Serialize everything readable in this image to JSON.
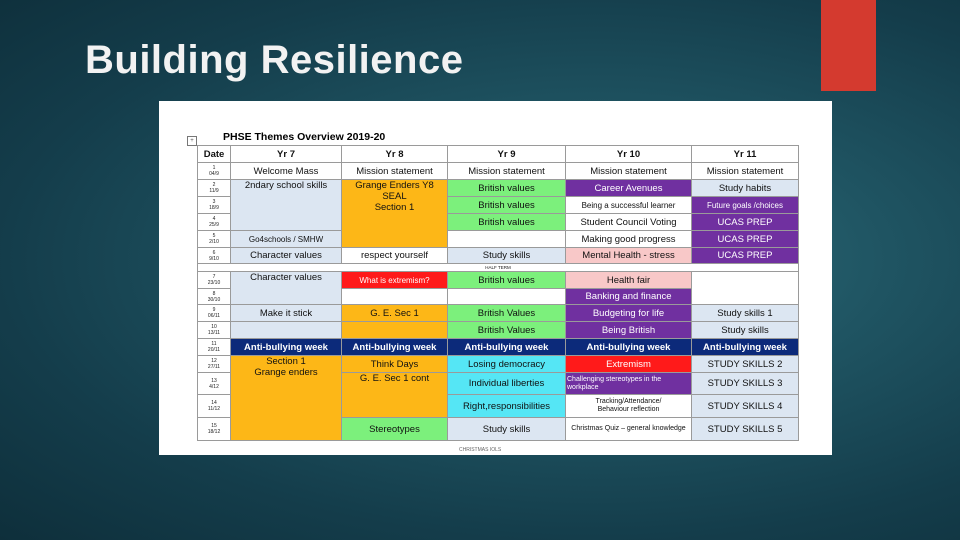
{
  "slide": {
    "title": "Building Resilience"
  },
  "doc": {
    "title": "PHSE Themes Overview 2019-20",
    "marker": "+",
    "half_term": "HALF TERM",
    "christmas": "CHRISTMAS  IOLS",
    "headers": [
      "Date",
      "Yr 7",
      "Yr 8",
      "Yr 9",
      "Yr 10",
      "Yr 11"
    ],
    "dates": [
      "1\n04/9",
      "2\n11/9",
      "3\n18/9",
      "4\n25/9",
      "5\n2/10",
      "6\n9/10",
      "7\n23/10",
      "8\n30/10",
      "9\n06/11",
      "10\n13/11",
      "11\n20/11",
      "12\n27/11",
      "13\n4/12",
      "14\n11/12",
      "15\n18/12"
    ],
    "cells": {
      "r1": [
        "Welcome Mass",
        "Mission statement",
        "Mission statement",
        "Mission statement",
        "Mission statement"
      ],
      "r2": [
        "2ndary school skills",
        "Grange Enders Y8\nSEAL\nSection 1",
        "British values",
        "Career Avenues",
        "Study habits"
      ],
      "r3": [
        "British values",
        "Being a successful learner",
        "Future goals /choices"
      ],
      "r4": [
        "British values",
        "Student Council Voting",
        "UCAS PREP"
      ],
      "r5": [
        "Go4schools / SMHW",
        "Making good progress",
        "UCAS PREP"
      ],
      "r6": [
        "Character values",
        "respect yourself",
        "Study skills",
        "Mental Health - stress",
        "UCAS PREP"
      ],
      "r7": [
        "Character values",
        "What is extremism?",
        "British values",
        "Health fair"
      ],
      "r8": [
        "Banking and finance"
      ],
      "r9": [
        "Make it stick",
        "G. E. Sec 1",
        "British Values",
        "Budgeting for life",
        "Study skills  1"
      ],
      "r10": [
        "British Values",
        "Being British",
        "Study skills"
      ],
      "r11": [
        "Anti-bullying week",
        "Anti-bullying week",
        "Anti-bullying week",
        "Anti-bullying week",
        "Anti-bullying week"
      ],
      "r12": [
        "Section 1\nGrange enders",
        "Think Days",
        "Losing democracy",
        "Extremism",
        "STUDY SKILLS 2"
      ],
      "r13": [
        "G. E. Sec 1 cont",
        "Individual liberties",
        "Challenging stereotypes in the workplace",
        "STUDY SKILLS 3"
      ],
      "r14": [
        "Right,responsibilities",
        "Tracking/Attendance/\nBehaviour reflection",
        "STUDY SKILLS 4"
      ],
      "r15": [
        "Stereotypes",
        "Study skills",
        "Christmas Quiz – general knowledge",
        "STUDY SKILLS 5"
      ]
    }
  }
}
